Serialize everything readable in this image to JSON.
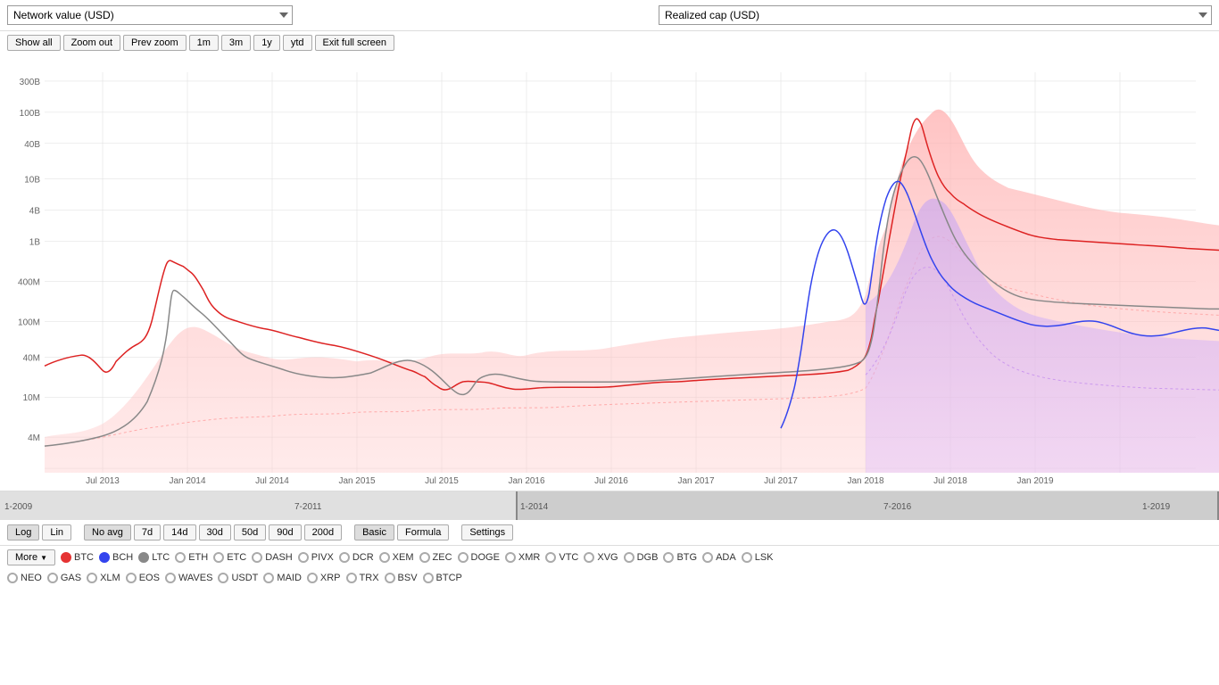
{
  "dropdowns": {
    "left": {
      "label": "Network value (USD)",
      "options": [
        "Network value (USD)"
      ]
    },
    "right": {
      "label": "Realized cap (USD)",
      "options": [
        "Realized cap (USD)"
      ]
    }
  },
  "controls": {
    "buttons": [
      "Show all",
      "Zoom out",
      "Prev zoom",
      "1m",
      "3m",
      "1y",
      "ytd",
      "Exit full screen"
    ]
  },
  "bottom_controls": {
    "scale": [
      "Log",
      "Lin"
    ],
    "avg": [
      "No avg",
      "7d",
      "14d",
      "30d",
      "50d",
      "90d",
      "200d"
    ],
    "mode": [
      "Basic",
      "Formula"
    ],
    "settings": "Settings"
  },
  "legend": {
    "more_label": "More",
    "row1": [
      {
        "id": "BTC",
        "label": "BTC",
        "color": "red",
        "checked": true
      },
      {
        "id": "BCH",
        "label": "BCH",
        "color": "blue",
        "checked": true
      },
      {
        "id": "LTC",
        "label": "LTC",
        "color": "gray",
        "checked": true
      },
      {
        "id": "ETH",
        "label": "ETH",
        "color": "none",
        "checked": false
      },
      {
        "id": "ETC",
        "label": "ETC",
        "color": "none",
        "checked": false
      },
      {
        "id": "DASH",
        "label": "DASH",
        "color": "none",
        "checked": false
      },
      {
        "id": "PIVX",
        "label": "PIVX",
        "color": "none",
        "checked": false
      },
      {
        "id": "DCR",
        "label": "DCR",
        "color": "none",
        "checked": false
      },
      {
        "id": "XEM",
        "label": "XEM",
        "color": "none",
        "checked": false
      },
      {
        "id": "ZEC",
        "label": "ZEC",
        "color": "none",
        "checked": false
      },
      {
        "id": "DOGE",
        "label": "DOGE",
        "color": "none",
        "checked": false
      },
      {
        "id": "XMR",
        "label": "XMR",
        "color": "none",
        "checked": false
      },
      {
        "id": "VTC",
        "label": "VTC",
        "color": "none",
        "checked": false
      },
      {
        "id": "XVG",
        "label": "XVG",
        "color": "none",
        "checked": false
      },
      {
        "id": "DGB",
        "label": "DGB",
        "color": "none",
        "checked": false
      },
      {
        "id": "BTG",
        "label": "BTG",
        "color": "none",
        "checked": false
      },
      {
        "id": "ADA",
        "label": "ADA",
        "color": "none",
        "checked": false
      },
      {
        "id": "LSK",
        "label": "LSK",
        "color": "none",
        "checked": false
      }
    ],
    "row2": [
      {
        "id": "NEO",
        "label": "NEO",
        "color": "none",
        "checked": false
      },
      {
        "id": "GAS",
        "label": "GAS",
        "color": "none",
        "checked": false
      },
      {
        "id": "XLM",
        "label": "XLM",
        "color": "none",
        "checked": false
      },
      {
        "id": "EOS",
        "label": "EOS",
        "color": "none",
        "checked": false
      },
      {
        "id": "WAVES",
        "label": "WAVES",
        "color": "none",
        "checked": false
      },
      {
        "id": "USDT",
        "label": "USDT",
        "color": "none",
        "checked": false
      },
      {
        "id": "MAID",
        "label": "MAID",
        "color": "none",
        "checked": false
      },
      {
        "id": "XRP",
        "label": "XRP",
        "color": "none",
        "checked": false
      },
      {
        "id": "TRX",
        "label": "TRX",
        "color": "none",
        "checked": false
      },
      {
        "id": "BSV",
        "label": "BSV",
        "color": "none",
        "checked": false
      },
      {
        "id": "BTCP",
        "label": "BTCP",
        "color": "none",
        "checked": false
      }
    ]
  },
  "y_axis": {
    "labels": [
      "300B",
      "100B",
      "40B",
      "10B",
      "4B",
      "1B",
      "400M",
      "100M",
      "40M",
      "10M",
      "4M"
    ]
  },
  "x_axis": {
    "labels": [
      "Jul 2013",
      "Jan 2014",
      "Jul 2014",
      "Jan 2015",
      "Jul 2015",
      "Jan 2016",
      "Jul 2016",
      "Jan 2017",
      "Jul 2017",
      "Jan 2018",
      "Jul 2018",
      "Jan 2019"
    ]
  }
}
